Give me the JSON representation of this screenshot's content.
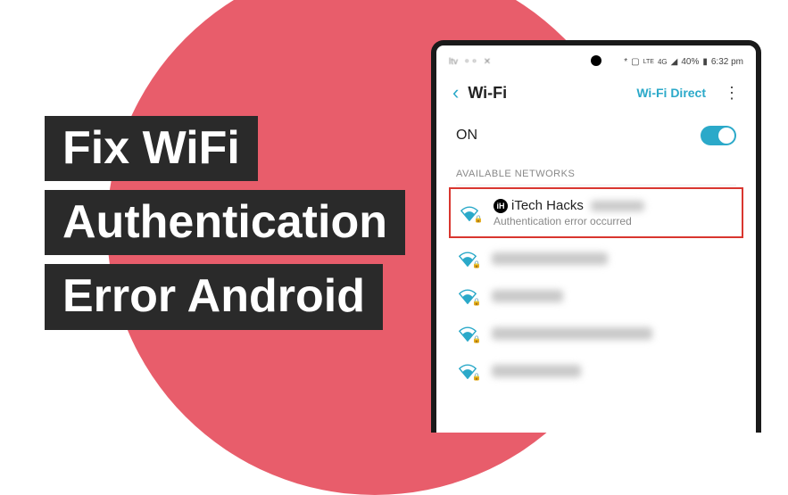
{
  "title": {
    "line1": "Fix WiFi",
    "line2": "Authentication",
    "line3": "Error Android"
  },
  "statusbar": {
    "left_text": "ltv",
    "signal_4g": "4G",
    "lte": "LTE",
    "battery": "40%",
    "time": "6:32 pm"
  },
  "header": {
    "title": "Wi-Fi",
    "direct": "Wi-Fi Direct"
  },
  "toggle": {
    "label": "ON"
  },
  "section_label": "AVAILABLE NETWORKS",
  "highlighted_network": {
    "logo": "iH",
    "name": "iTech Hacks",
    "sub": "Authentication error occurred"
  }
}
